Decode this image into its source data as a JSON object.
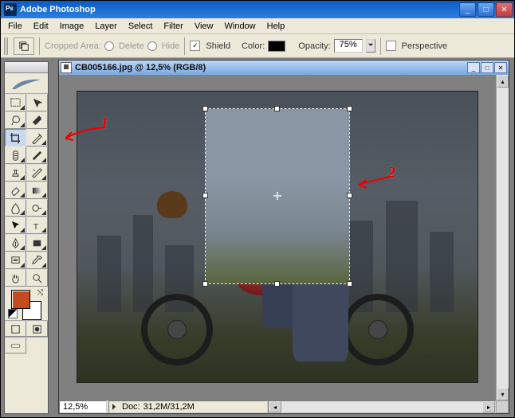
{
  "app": {
    "title": "Adobe Photoshop"
  },
  "menu": [
    "File",
    "Edit",
    "Image",
    "Layer",
    "Select",
    "Filter",
    "View",
    "Window",
    "Help"
  ],
  "options": {
    "cropped_area_label": "Cropped Area:",
    "delete_label": "Delete",
    "hide_label": "Hide",
    "shield_label": "Shield",
    "shield_checked": "✓",
    "color_label": "Color:",
    "opacity_label": "Opacity:",
    "opacity_value": "75%",
    "perspective_label": "Perspective",
    "perspective_checked": ""
  },
  "document": {
    "title": "CB005166.jpg @ 12,5% (RGB/8)",
    "zoom": "12,5%",
    "status_label": "Doc:",
    "status_value": "31,2M/31,2M"
  },
  "colors": {
    "foreground": "#c54a1e",
    "background": "#ffffff",
    "shield_color": "#000000"
  },
  "annotations": {
    "one": "1",
    "two": "2"
  },
  "tool_names": {
    "marquee": "rectangular-marquee-tool",
    "move": "move-tool",
    "lasso": "lasso-tool",
    "wand": "magic-wand-tool",
    "crop": "crop-tool",
    "slice": "slice-tool",
    "heal": "healing-brush-tool",
    "brush": "brush-tool",
    "stamp": "clone-stamp-tool",
    "history": "history-brush-tool",
    "eraser": "eraser-tool",
    "gradient": "gradient-tool",
    "blur": "blur-tool",
    "dodge": "dodge-tool",
    "path": "path-selection-tool",
    "type": "type-tool",
    "pen": "pen-tool",
    "shape": "rectangle-tool",
    "notes": "notes-tool",
    "eyedrop": "eyedropper-tool",
    "hand": "hand-tool",
    "zoom": "zoom-tool"
  }
}
